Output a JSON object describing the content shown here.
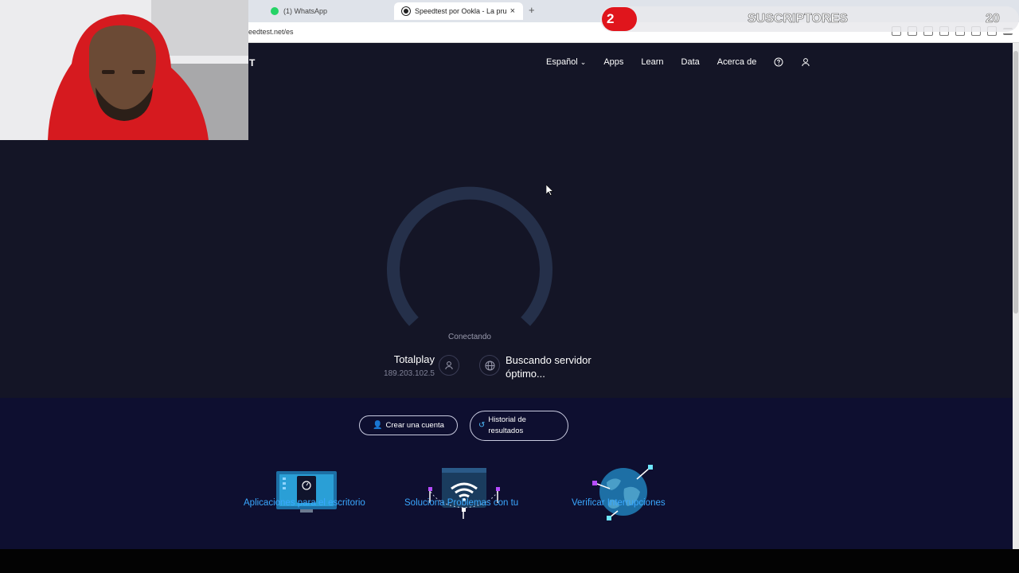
{
  "browser": {
    "tabs": [
      {
        "label": "(1) WhatsApp",
        "favicon": "whatsapp-icon"
      },
      {
        "label": "Speedtest por Ookla - La prueba",
        "favicon": "speedtest-icon",
        "close": "×"
      }
    ],
    "new_tab": "+",
    "url": "eedtest.net/es"
  },
  "site": {
    "logo_fragment": "T",
    "nav": {
      "language": "Español",
      "language_chevron": "⌄",
      "apps": "Apps",
      "learn": "Learn",
      "data": "Data",
      "about": "Acerca de"
    }
  },
  "test": {
    "status": "Conectando",
    "isp_name": "Totalplay",
    "ip": "189.203.102.5",
    "server_status": "Buscando servidor óptimo..."
  },
  "actions": {
    "create_account": "Crear una cuenta",
    "history": "Historial de resultados"
  },
  "features": [
    {
      "title": "Aplicaciones para el escritorio",
      "icon": "desktop-app-icon"
    },
    {
      "title": "Soluciona Problemas con tu",
      "icon": "wifi-troubleshoot-icon"
    },
    {
      "title": "Verificar Interrupciones",
      "icon": "globe-outage-icon"
    }
  ],
  "overlay": {
    "banner_number": "2",
    "banner_text": "SUSCRIPTORES",
    "banner_count": "20"
  },
  "colors": {
    "page_bg": "#141526",
    "lower_bg": "#0e0f30",
    "gauge": "#2a3550",
    "link": "#3aa8ff",
    "banner_red": "#e0151c"
  }
}
